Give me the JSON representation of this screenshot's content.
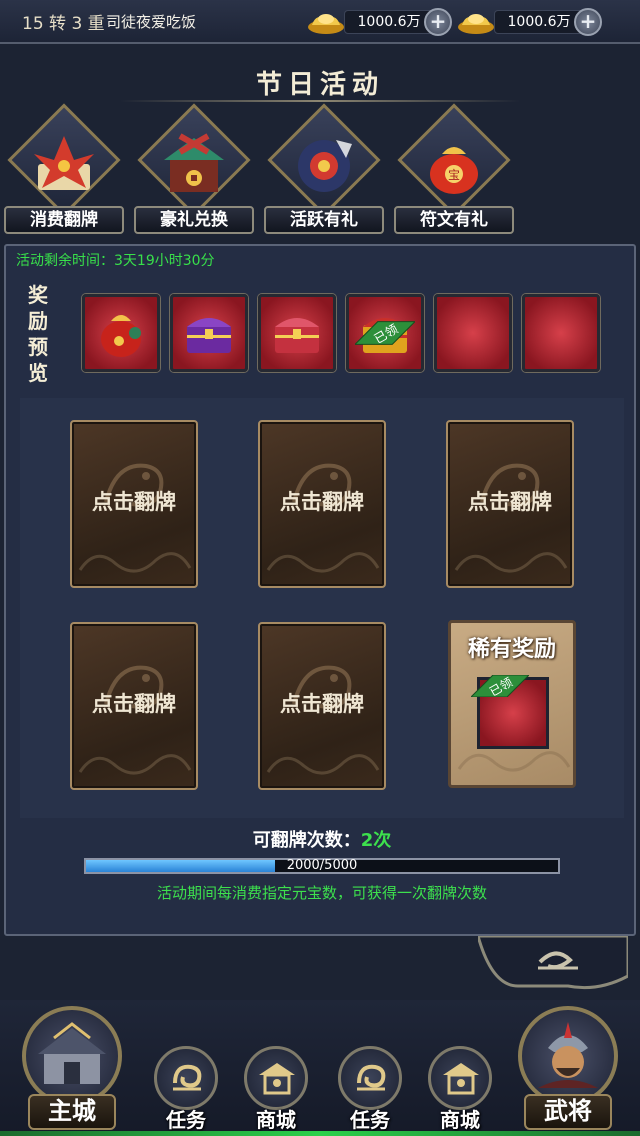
{
  "header": {
    "level": "15 转 3 重",
    "player_name": "司徒夜爱吃饭",
    "currencies": [
      {
        "icon": "gold-ingot-icon",
        "amount": "1000.6万"
      },
      {
        "icon": "gold-ingot-icon",
        "amount": "1000.6万"
      }
    ]
  },
  "title": "节日活动",
  "activities": [
    {
      "label": "消费翻牌",
      "icon": "red-flower-scroll-icon"
    },
    {
      "label": "豪礼兑换",
      "icon": "gift-shop-icon"
    },
    {
      "label": "活跃有礼",
      "icon": "gift-box-icon"
    },
    {
      "label": "符文有礼",
      "icon": "lucky-bag-icon"
    }
  ],
  "panel": {
    "timer": "活动剩余时间：3天19小时30分",
    "reward_preview_label": "奖励预览",
    "reward_slots": [
      {
        "icon": "red-lucky-bag-icon",
        "claimed": false
      },
      {
        "icon": "purple-chest-icon",
        "claimed": false
      },
      {
        "icon": "red-chest-icon",
        "claimed": false
      },
      {
        "icon": "gold-chest-icon",
        "claimed": true
      },
      {
        "icon": "empty",
        "claimed": false
      },
      {
        "icon": "empty",
        "claimed": false
      }
    ],
    "claimed_tag": "已领",
    "card_text": "点击翻牌",
    "rare_title": "稀有奖励",
    "flip_count_label": "可翻牌次数：",
    "flip_count_value": "2次",
    "progress_text": "2000/5000",
    "progress_fraction": 0.4,
    "hint": "活动期间每消费指定元宝数，可获得一次翻牌次数"
  },
  "nav": {
    "main_city": "主城",
    "items": [
      "任务",
      "商城",
      "任务",
      "商城"
    ],
    "general": "武将"
  },
  "colors": {
    "accent_green": "#3de04d",
    "card_border": "#a78b63",
    "slot_red": "#c22a34"
  }
}
